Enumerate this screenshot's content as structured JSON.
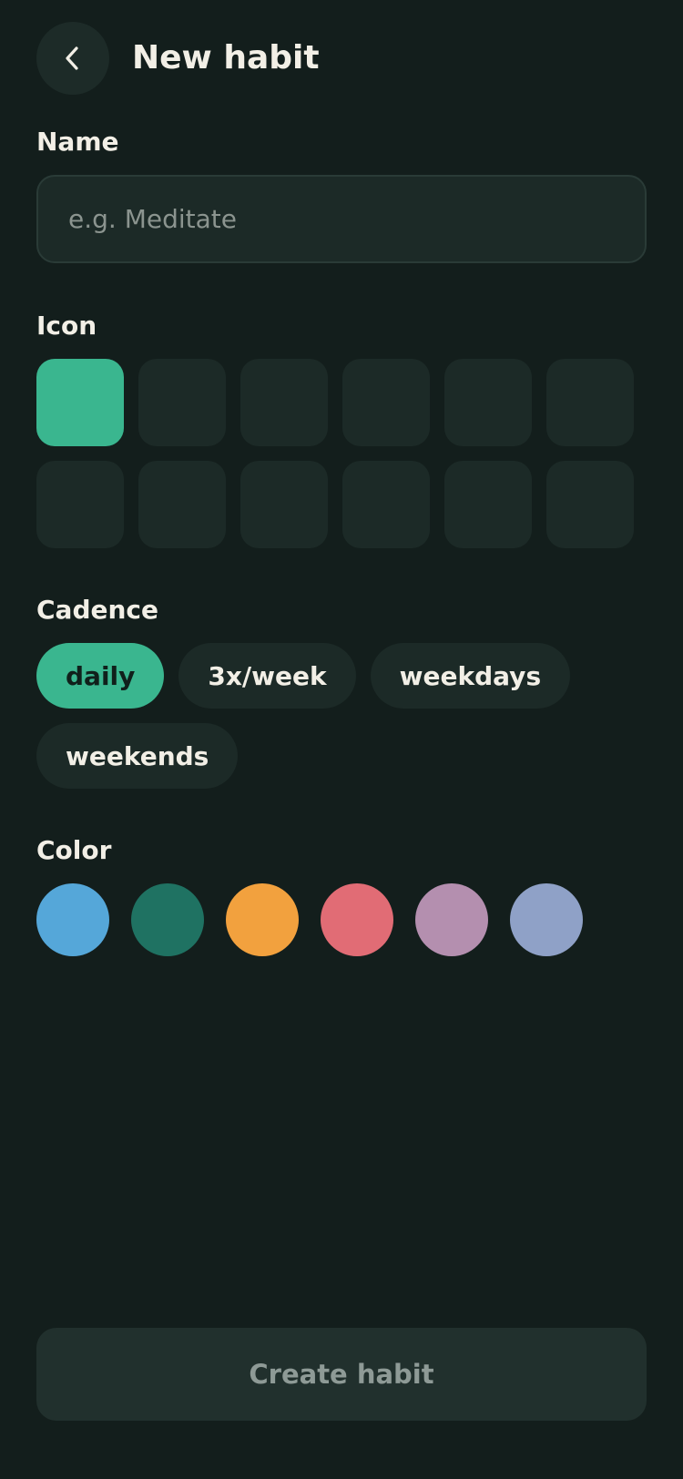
{
  "header": {
    "back_icon": "chevron-left-icon",
    "title": "New habit"
  },
  "name_section": {
    "label": "Name",
    "value": "",
    "placeholder": "e.g. Meditate"
  },
  "icon_section": {
    "label": "Icon",
    "selected_index": 0,
    "tiles": 12
  },
  "cadence_section": {
    "label": "Cadence",
    "options": [
      "daily",
      "3x/week",
      "weekdays",
      "weekends"
    ],
    "selected": "daily"
  },
  "color_section": {
    "label": "Color",
    "swatches": [
      "#55a7d9",
      "#1f7262",
      "#f2a13e",
      "#e16c75",
      "#b48faf",
      "#8fa1c7"
    ]
  },
  "actions": {
    "create_label": "Create habit"
  },
  "colors": {
    "background": "#131e1c",
    "surface": "#1c2a27",
    "accent": "#3ab68f",
    "text": "#f2efe6",
    "muted_text": "#8e9a96"
  }
}
